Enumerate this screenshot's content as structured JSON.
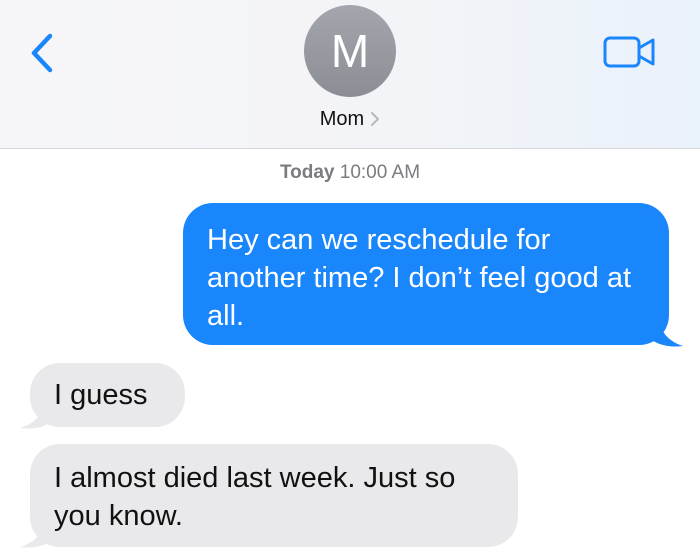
{
  "header": {
    "avatar_initial": "M",
    "contact_name": "Mom",
    "icons": {
      "back": "chevron-left-icon",
      "video": "video-camera-icon",
      "contact_chevron": "chevron-right-icon"
    },
    "colors": {
      "accent": "#1a86fb",
      "avatar": "#9a9da3"
    }
  },
  "conversation": {
    "timestamp_day": "Today",
    "timestamp_time": "10:00 AM",
    "messages": [
      {
        "direction": "outgoing",
        "text": "Hey can we reschedule for another time? I don’t feel good at all."
      },
      {
        "direction": "incoming",
        "text": "I guess"
      },
      {
        "direction": "incoming",
        "text": "I almost died last week. Just so you know."
      }
    ],
    "colors": {
      "outgoing_bubble": "#1a86fb",
      "incoming_bubble": "#e9e9eb"
    }
  }
}
